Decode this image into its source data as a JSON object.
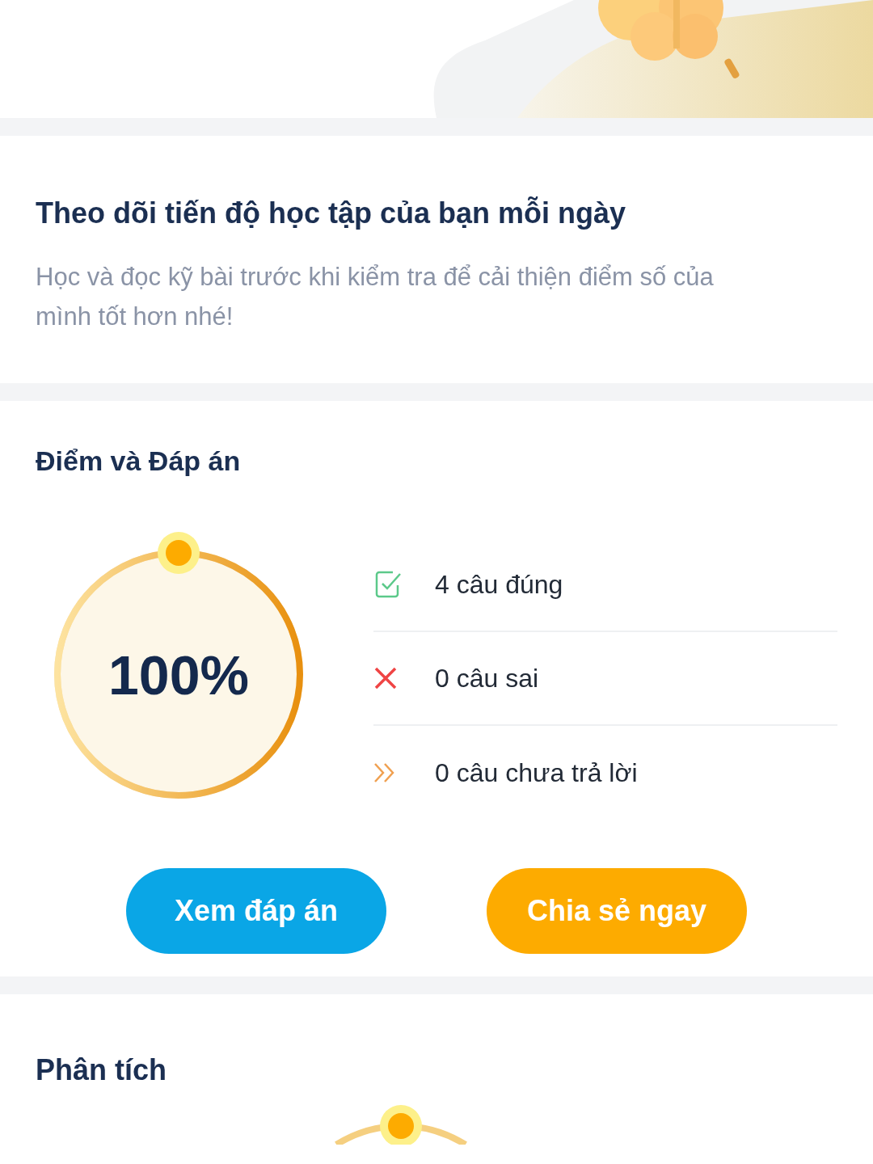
{
  "progress_intro": {
    "title": "Theo dõi tiến độ học tập của bạn mỗi ngày",
    "description": "Học và đọc kỹ bài trước khi kiểm tra để cải thiện điểm số của mình tốt hơn nhé!"
  },
  "score": {
    "title": "Điểm và Đáp án",
    "ring": {
      "label": "100%"
    },
    "stats": [
      {
        "kind": "correct",
        "label": "4 câu đúng"
      },
      {
        "kind": "wrong",
        "label": "0 câu sai"
      },
      {
        "kind": "skipped",
        "label": "0 câu chưa trả lời"
      }
    ],
    "buttons": [
      {
        "kind": "primary",
        "label": "Xem đáp án"
      },
      {
        "kind": "secondary",
        "label": "Chia sẻ ngay"
      }
    ]
  },
  "analysis": {
    "title": "Phân tích"
  }
}
